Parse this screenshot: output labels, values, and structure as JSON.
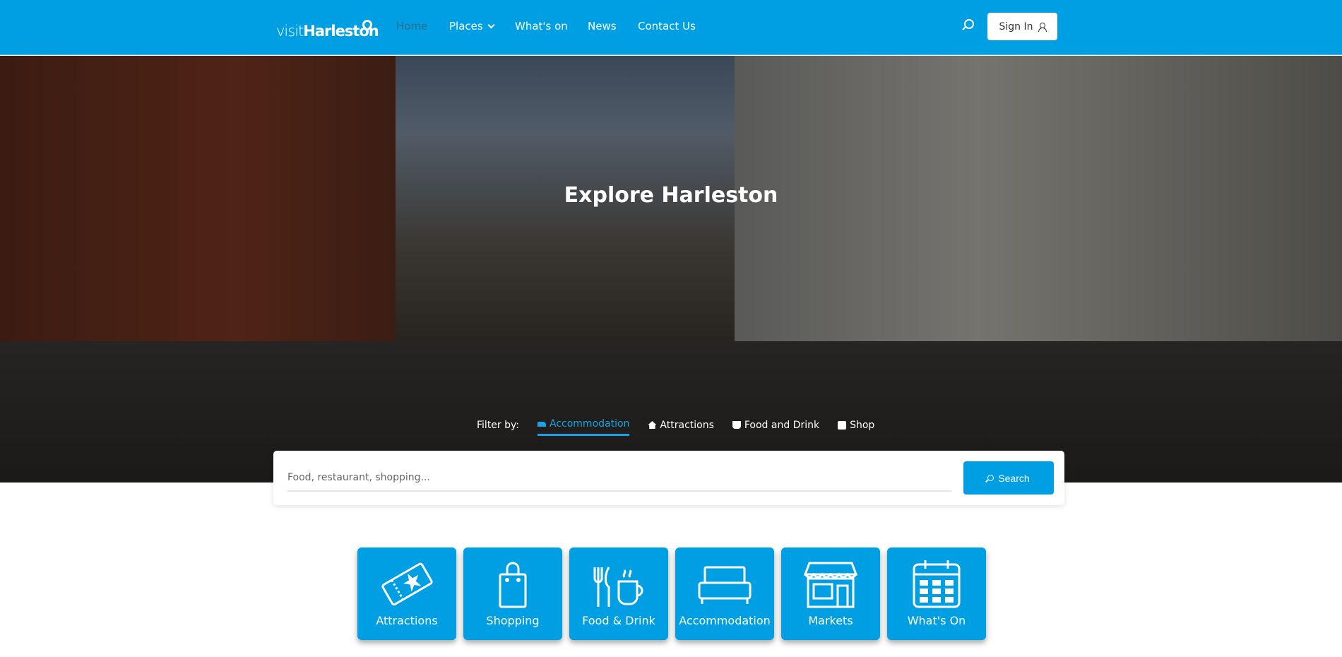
{
  "brand": {
    "visit": "visit",
    "name": "Harleston"
  },
  "nav": {
    "items": [
      {
        "label": "Home",
        "active": true
      },
      {
        "label": "Places",
        "dropdown": true
      },
      {
        "label": "What's on"
      },
      {
        "label": "News"
      },
      {
        "label": "Contact Us"
      }
    ],
    "sign_in": "Sign In"
  },
  "hero": {
    "title": "Explore Harleston",
    "filter_label": "Filter by:",
    "filters": [
      {
        "label": "Accommodation",
        "icon": "bed-icon",
        "active": true
      },
      {
        "label": "Attractions",
        "icon": "home-icon"
      },
      {
        "label": "Food and Drink",
        "icon": "coffee-icon"
      },
      {
        "label": "Shop",
        "icon": "shopping-bag-icon"
      }
    ]
  },
  "search": {
    "placeholder": "Food, restaurant, shopping...",
    "value": "",
    "button": "Search"
  },
  "categories": [
    {
      "label": "Attractions",
      "icon": "ticket-icon"
    },
    {
      "label": "Shopping",
      "icon": "shopping-bag-icon"
    },
    {
      "label": "Food & Drink",
      "icon": "cutlery-cup-icon"
    },
    {
      "label": "Accommodation",
      "icon": "bed-icon"
    },
    {
      "label": "Markets",
      "icon": "storefront-icon"
    },
    {
      "label": "What's On",
      "icon": "calendar-icon"
    }
  ],
  "colors": {
    "brand": "#009fe3",
    "active_filter": "#1aa3e8"
  }
}
